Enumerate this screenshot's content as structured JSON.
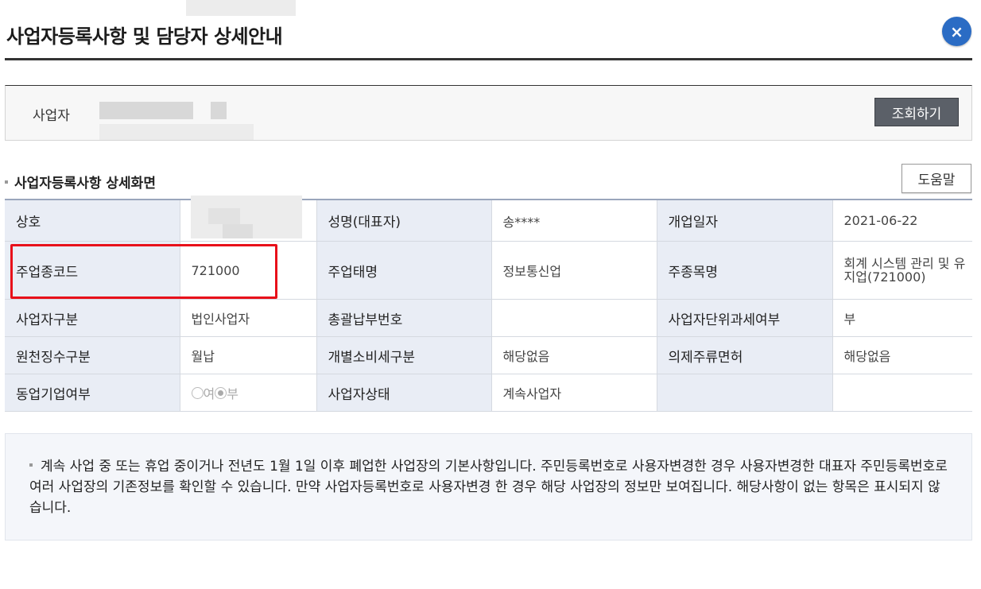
{
  "header": {
    "title": "사업자등록사항 및 담당자 상세안내",
    "close_icon": "×"
  },
  "search": {
    "label": "사업자",
    "button": "조회하기"
  },
  "section": {
    "title": "사업자등록사항 상세화면",
    "help_button": "도움말"
  },
  "table": {
    "rows": [
      [
        {
          "label": "상호"
        },
        {
          "value": ""
        },
        {
          "label": "성명(대표자)"
        },
        {
          "value": "송****"
        },
        {
          "label": "개업일자"
        },
        {
          "value": "2021-06-22"
        }
      ],
      [
        {
          "label": "주업종코드"
        },
        {
          "value": "721000"
        },
        {
          "label": "주업태명"
        },
        {
          "value": "정보통신업"
        },
        {
          "label": "주종목명"
        },
        {
          "value": "회계 시스템 관리 및 유지업(721000)"
        }
      ],
      [
        {
          "label": "사업자구분"
        },
        {
          "value": "법인사업자"
        },
        {
          "label": "총괄납부번호"
        },
        {
          "value": ""
        },
        {
          "label": "사업자단위과세여부"
        },
        {
          "value": "부"
        }
      ],
      [
        {
          "label": "원천징수구분"
        },
        {
          "value": "월납"
        },
        {
          "label": "개별소비세구분"
        },
        {
          "value": "해당없음"
        },
        {
          "label": "의제주류면허"
        },
        {
          "value": "해당없음"
        }
      ],
      [
        {
          "label": "동업기업여부"
        },
        {
          "radio": [
            "여",
            "부"
          ],
          "selected": "부"
        },
        {
          "label": "사업자상태"
        },
        {
          "value": "계속사업자"
        },
        {
          "label": ""
        },
        {
          "value": ""
        }
      ]
    ]
  },
  "notice": {
    "text": "계속 사업 중 또는 휴업 중이거나 전년도 1월 1일 이후 폐업한 사업장의 기본사항입니다. 주민등록번호로 사용자변경한 경우 사용자변경한 대표자 주민등록번호로 여러 사업장의 기존정보를 확인할 수 있습니다. 만약 사업자등록번호로 사용자변경 한 경우 해당 사업장의 정보만 보여집니다. 해당사항이 없는 항목은 표시되지 않습니다."
  },
  "colors": {
    "highlight": "#e8101a",
    "close_button": "#2b6cc4",
    "header_cell": "#e9edf5",
    "search_button": "#5b6068"
  }
}
